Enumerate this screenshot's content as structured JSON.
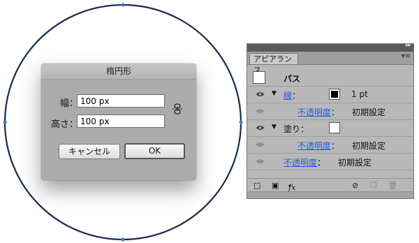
{
  "dialog": {
    "title": "楕円形",
    "width_label": "幅：",
    "width_value": "100 px",
    "height_label": "高さ：",
    "height_value": "100 px",
    "cancel_label": "キャンセル",
    "ok_label": "OK"
  },
  "appearance_panel": {
    "tab_label": "アピアランス",
    "object_label": "パス",
    "stroke_label": "線",
    "stroke_colon": "：",
    "stroke_weight": "1 pt",
    "opacity_label": "不透明度",
    "opacity_colon": "：",
    "default_setting": "初期設定",
    "fill_label": "塗り：",
    "fx_label": "fx"
  },
  "colors": {
    "ellipse_stroke": "#1a2a4a",
    "anchor_point": "#3b7be0",
    "link_blue": "#1f5ee0",
    "dialog_bg": "#ababab",
    "panel_bg": "#b8b8b8"
  },
  "icons": [
    "link-constrain-icon",
    "eye-icon",
    "disclosure-triangle-icon",
    "new-stroke-icon",
    "new-fill-icon",
    "clear-appearance-icon",
    "duplicate-item-icon",
    "delete-icon",
    "panel-menu-icon"
  ]
}
